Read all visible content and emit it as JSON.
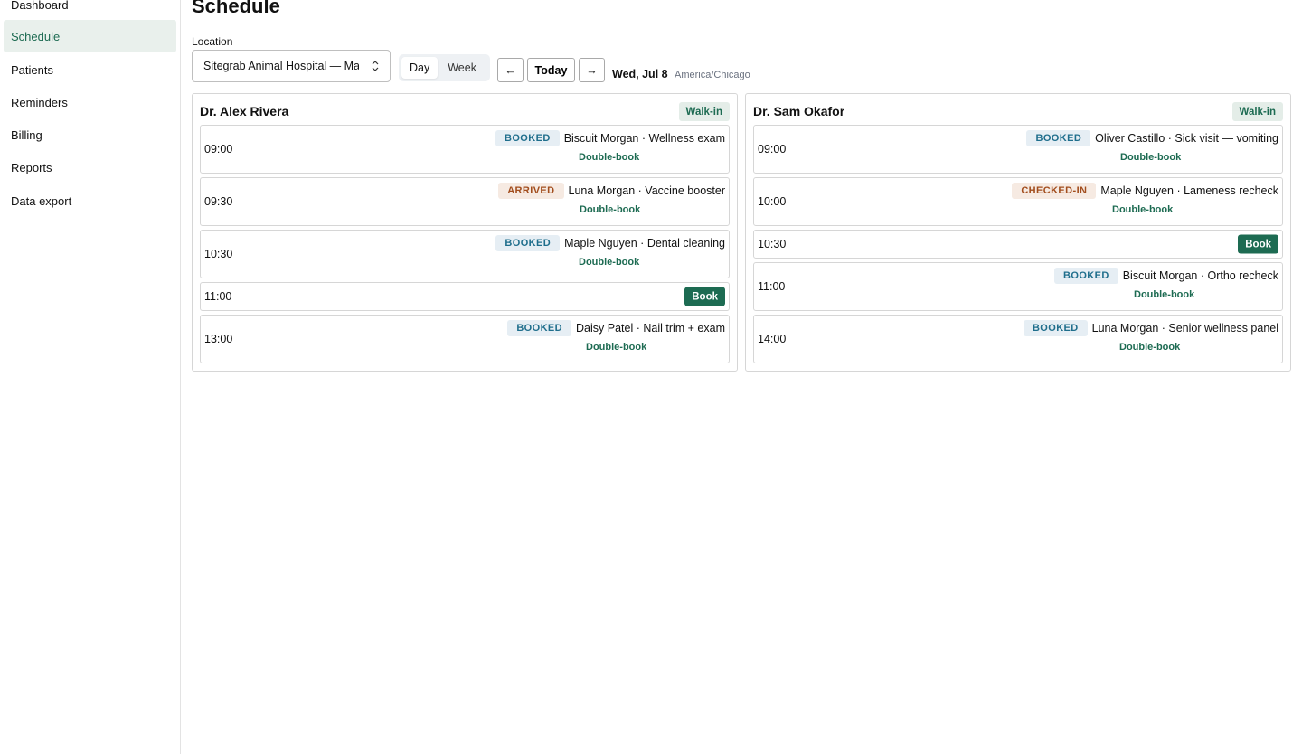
{
  "sidebar": {
    "items": [
      {
        "label": "Dashboard"
      },
      {
        "label": "Schedule",
        "active": true
      },
      {
        "label": "Patients"
      },
      {
        "label": "Reminders"
      },
      {
        "label": "Billing"
      },
      {
        "label": "Reports"
      },
      {
        "label": "Data export"
      }
    ]
  },
  "header": {
    "title": "Schedule",
    "location_label": "Location",
    "location_value": "Sitegrab Animal Hospital — Main",
    "view_tabs": [
      {
        "label": "Day",
        "active": true
      },
      {
        "label": "Week"
      }
    ],
    "prev_label": "←",
    "today_label": "Today",
    "next_label": "→",
    "date": "Wed, Jul 8",
    "timezone": "America/Chicago"
  },
  "colors": {
    "accent": "#1d6b52",
    "booked_bg": "#e6eef4",
    "booked_text": "#1f6e8c",
    "arrived_bg": "#f6eae2",
    "arrived_text": "#a24d1d"
  },
  "columns": [
    {
      "doctor": "Dr. Alex Rivera",
      "walkin_label": "Walk-in",
      "slots": [
        {
          "time": "09:00",
          "status": "BOOKED",
          "desc": "Biscuit Morgan · Wellness exam",
          "action": "Double-book"
        },
        {
          "time": "09:30",
          "status": "ARRIVED",
          "desc": "Luna Morgan · Vaccine booster",
          "action": "Double-book"
        },
        {
          "time": "10:30",
          "status": "BOOKED",
          "desc": "Maple Nguyen · Dental cleaning",
          "action": "Double-book"
        },
        {
          "time": "11:00",
          "action": "Book"
        },
        {
          "time": "13:00",
          "status": "BOOKED",
          "desc": "Daisy Patel · Nail trim + exam",
          "action": "Double-book"
        }
      ]
    },
    {
      "doctor": "Dr. Sam Okafor",
      "walkin_label": "Walk-in",
      "slots": [
        {
          "time": "09:00",
          "status": "BOOKED",
          "desc": "Oliver Castillo · Sick visit — vomiting",
          "action": "Double-book"
        },
        {
          "time": "10:00",
          "status": "CHECKED-IN",
          "desc": "Maple Nguyen · Lameness recheck",
          "action": "Double-book"
        },
        {
          "time": "10:30",
          "action": "Book"
        },
        {
          "time": "11:00",
          "status": "BOOKED",
          "desc": "Biscuit Morgan · Ortho recheck",
          "action": "Double-book"
        },
        {
          "time": "14:00",
          "status": "BOOKED",
          "desc": "Luna Morgan · Senior wellness panel",
          "action": "Double-book"
        }
      ]
    }
  ]
}
